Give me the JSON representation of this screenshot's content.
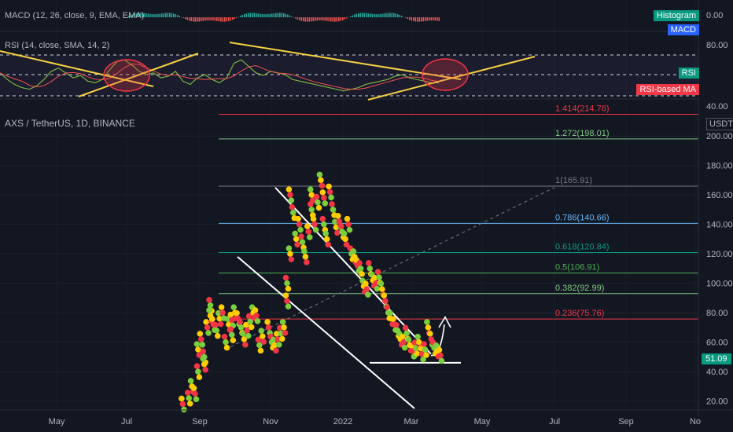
{
  "chart_data": {
    "type": "scatter",
    "title": "AXS / TetherUS, 1D, BINANCE",
    "quote_currency": "USDT",
    "last_price": "51.09",
    "x_labels": [
      "May",
      "Jul",
      "Sep",
      "Nov",
      "2022",
      "Mar",
      "May",
      "Jul",
      "Sep",
      "No"
    ],
    "y_ticks": [
      "200.00",
      "180.00",
      "160.00",
      "140.00",
      "120.00",
      "100.00",
      "80.00",
      "60.00",
      "40.00",
      "20.00"
    ],
    "ylim": [
      15,
      215
    ],
    "fib_levels": [
      {
        "label": "1.414(214.76)",
        "value": 214.76,
        "color": "#f23645"
      },
      {
        "label": "1.272(198.01)",
        "value": 198.01,
        "color": "#81c784"
      },
      {
        "label": "1(165.91)",
        "value": 165.91,
        "color": "#787b86"
      },
      {
        "label": "0.786(140.66)",
        "value": 140.66,
        "color": "#64b5f6"
      },
      {
        "label": "0.618(120.84)",
        "value": 120.84,
        "color": "#089981"
      },
      {
        "label": "0.5(106.91)",
        "value": 106.91,
        "color": "#4caf50"
      },
      {
        "label": "0.382(92.99)",
        "value": 92.99,
        "color": "#81c784"
      },
      {
        "label": "0.236(75.76)",
        "value": 75.76,
        "color": "#f23645"
      }
    ],
    "price_points": [
      [
        0.16,
        18
      ],
      [
        0.18,
        22
      ],
      [
        0.19,
        30
      ],
      [
        0.2,
        25
      ],
      [
        0.21,
        40
      ],
      [
        0.21,
        55
      ],
      [
        0.22,
        62
      ],
      [
        0.23,
        50
      ],
      [
        0.23,
        45
      ],
      [
        0.24,
        70
      ],
      [
        0.25,
        85
      ],
      [
        0.25,
        78
      ],
      [
        0.26,
        72
      ],
      [
        0.27,
        68
      ],
      [
        0.28,
        76
      ],
      [
        0.29,
        80
      ],
      [
        0.3,
        60
      ],
      [
        0.31,
        72
      ],
      [
        0.32,
        75
      ],
      [
        0.32,
        65
      ],
      [
        0.33,
        80
      ],
      [
        0.34,
        76
      ],
      [
        0.35,
        70
      ],
      [
        0.36,
        62
      ],
      [
        0.37,
        68
      ],
      [
        0.38,
        74
      ],
      [
        0.39,
        80
      ],
      [
        0.4,
        78
      ],
      [
        0.41,
        58
      ],
      [
        0.42,
        64
      ],
      [
        0.44,
        70
      ],
      [
        0.45,
        60
      ],
      [
        0.46,
        58
      ],
      [
        0.47,
        62
      ],
      [
        0.48,
        66
      ],
      [
        0.49,
        70
      ],
      [
        0.5,
        88
      ],
      [
        0.5,
        100
      ],
      [
        0.51,
        120
      ],
      [
        0.51,
        160
      ],
      [
        0.52,
        148
      ],
      [
        0.53,
        130
      ],
      [
        0.54,
        140
      ],
      [
        0.55,
        128
      ],
      [
        0.56,
        118
      ],
      [
        0.57,
        135
      ],
      [
        0.58,
        150
      ],
      [
        0.58,
        160
      ],
      [
        0.59,
        140
      ],
      [
        0.6,
        155
      ],
      [
        0.61,
        170
      ],
      [
        0.62,
        158
      ],
      [
        0.62,
        140
      ],
      [
        0.63,
        130
      ],
      [
        0.64,
        162
      ],
      [
        0.65,
        150
      ],
      [
        0.66,
        138
      ],
      [
        0.67,
        142
      ],
      [
        0.68,
        135
      ],
      [
        0.69,
        130
      ],
      [
        0.7,
        140
      ],
      [
        0.71,
        120
      ],
      [
        0.72,
        118
      ],
      [
        0.73,
        112
      ],
      [
        0.74,
        110
      ],
      [
        0.75,
        98
      ],
      [
        0.76,
        96
      ],
      [
        0.77,
        110
      ],
      [
        0.78,
        102
      ],
      [
        0.79,
        100
      ],
      [
        0.8,
        104
      ],
      [
        0.81,
        96
      ],
      [
        0.82,
        88
      ],
      [
        0.83,
        80
      ],
      [
        0.84,
        76
      ],
      [
        0.85,
        72
      ],
      [
        0.86,
        68
      ],
      [
        0.87,
        62
      ],
      [
        0.88,
        60
      ],
      [
        0.89,
        66
      ],
      [
        0.9,
        58
      ],
      [
        0.91,
        54
      ],
      [
        0.92,
        56
      ],
      [
        0.93,
        60
      ],
      [
        0.94,
        52
      ],
      [
        0.95,
        55
      ],
      [
        0.96,
        70
      ],
      [
        0.97,
        62
      ],
      [
        0.98,
        56
      ],
      [
        0.99,
        54
      ],
      [
        1.0,
        51
      ]
    ],
    "macd_label": "MACD (12, 26, close, 9, EMA, EMA)",
    "macd_axis": "0.00",
    "histogram_badge": "Histogram",
    "macd_badge": "MACD",
    "rsi_label": "RSI (14, close, SMA, 14, 2)",
    "rsi_ticks": [
      "80.00",
      "40.00"
    ],
    "rsi_badge": "RSI",
    "rsi_ma_badge": "RSI-based MA",
    "rsi_values": [
      58,
      50,
      44,
      40,
      38,
      42,
      50,
      60,
      64,
      58,
      52,
      55,
      48,
      46,
      50,
      62,
      72,
      74,
      68,
      60,
      56,
      58,
      52,
      54,
      60,
      48,
      44,
      52,
      56,
      50,
      46,
      52,
      70,
      74,
      66,
      58,
      55,
      60,
      58,
      56,
      50,
      48,
      46,
      44,
      42,
      40,
      38,
      36,
      38,
      40,
      44,
      46,
      48,
      50,
      54,
      56,
      52,
      50,
      48,
      46,
      46
    ]
  }
}
